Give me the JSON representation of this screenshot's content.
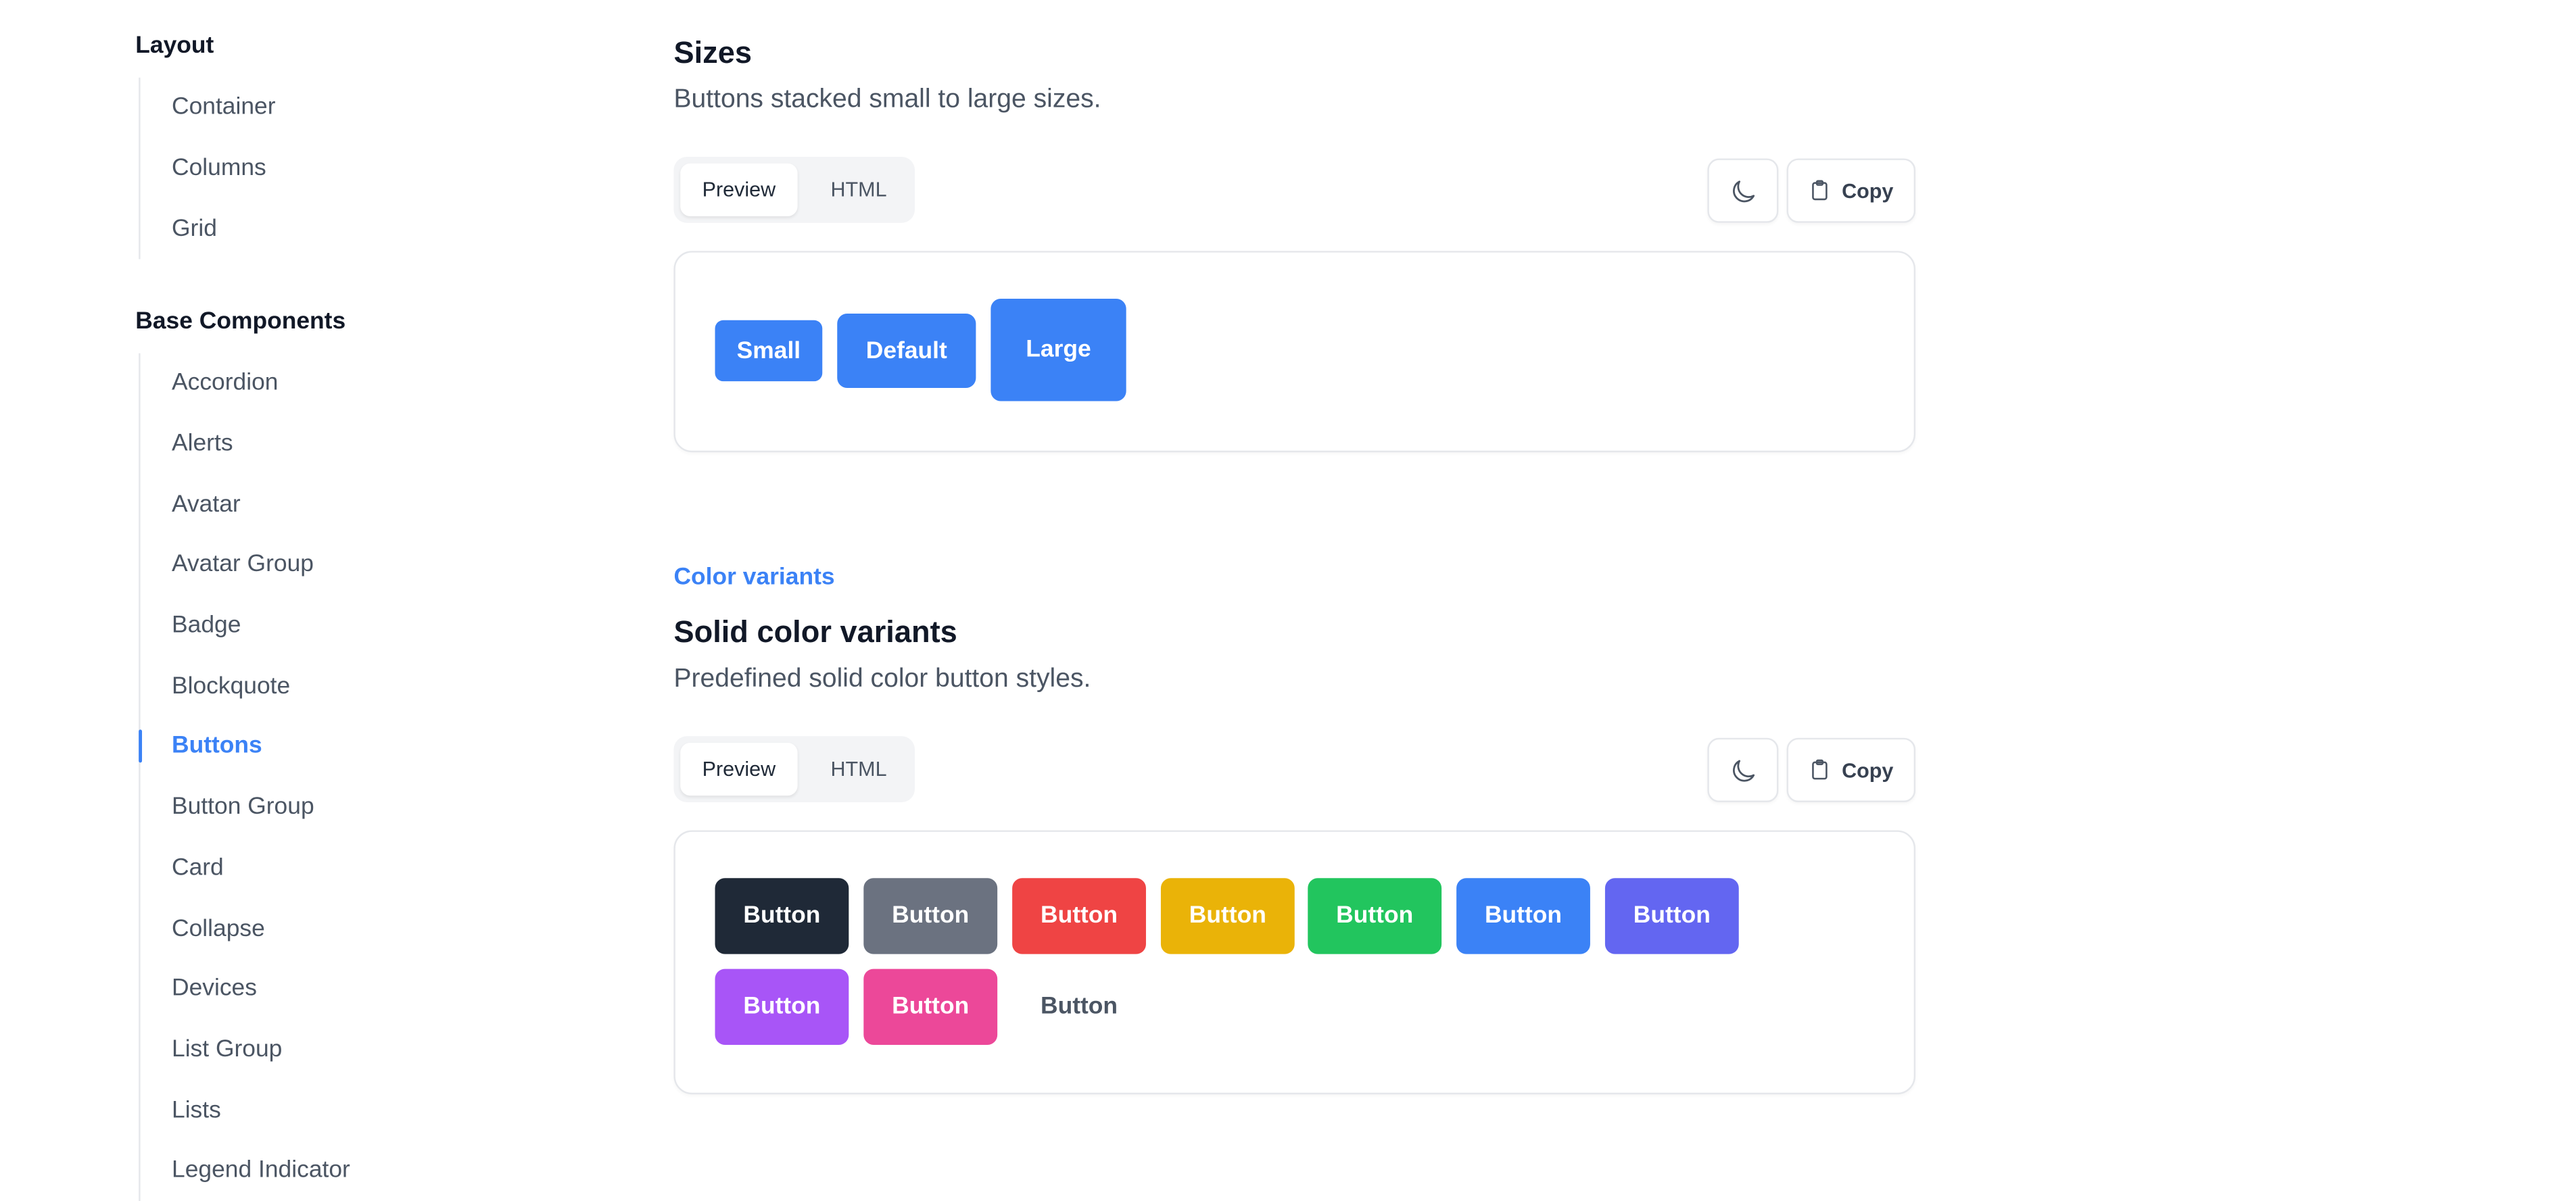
{
  "sidebar": {
    "groups": [
      {
        "title": "Layout",
        "items": [
          {
            "label": "Container",
            "active": false
          },
          {
            "label": "Columns",
            "active": false
          },
          {
            "label": "Grid",
            "active": false
          }
        ]
      },
      {
        "title": "Base Components",
        "items": [
          {
            "label": "Accordion",
            "active": false
          },
          {
            "label": "Alerts",
            "active": false
          },
          {
            "label": "Avatar",
            "active": false
          },
          {
            "label": "Avatar Group",
            "active": false
          },
          {
            "label": "Badge",
            "active": false
          },
          {
            "label": "Blockquote",
            "active": false
          },
          {
            "label": "Buttons",
            "active": true
          },
          {
            "label": "Button Group",
            "active": false
          },
          {
            "label": "Card",
            "active": false
          },
          {
            "label": "Collapse",
            "active": false
          },
          {
            "label": "Devices",
            "active": false
          },
          {
            "label": "List Group",
            "active": false
          },
          {
            "label": "Lists",
            "active": false
          },
          {
            "label": "Legend Indicator",
            "active": false
          }
        ]
      }
    ]
  },
  "sections": {
    "sizes": {
      "title": "Sizes",
      "description": "Buttons stacked small to large sizes.",
      "tabs": {
        "preview": "Preview",
        "html": "HTML",
        "selected": "Preview"
      },
      "copy_label": "Copy",
      "dark_mode_icon": "moon-icon",
      "copy_icon": "clipboard-icon",
      "buttons": [
        {
          "label": "Small",
          "size": "small",
          "color": "#3b82f6"
        },
        {
          "label": "Default",
          "size": "default",
          "color": "#3b82f6"
        },
        {
          "label": "Large",
          "size": "large",
          "color": "#3b82f6"
        }
      ]
    },
    "solid": {
      "eyebrow": "Color variants",
      "title": "Solid color variants",
      "description": "Predefined solid color button styles.",
      "tabs": {
        "preview": "Preview",
        "html": "HTML",
        "selected": "Preview"
      },
      "copy_label": "Copy",
      "dark_mode_icon": "moon-icon",
      "copy_icon": "clipboard-icon",
      "buttons": [
        {
          "label": "Button",
          "variant": "dark",
          "color": "#1f2937"
        },
        {
          "label": "Button",
          "variant": "gray",
          "color": "#6b7280"
        },
        {
          "label": "Button",
          "variant": "red",
          "color": "#ef4444"
        },
        {
          "label": "Button",
          "variant": "yellow",
          "color": "#eab308"
        },
        {
          "label": "Button",
          "variant": "green",
          "color": "#22c55e"
        },
        {
          "label": "Button",
          "variant": "blue",
          "color": "#3b82f6"
        },
        {
          "label": "Button",
          "variant": "indigo",
          "color": "#6366f1"
        },
        {
          "label": "Button",
          "variant": "purple",
          "color": "#a855f7"
        },
        {
          "label": "Button",
          "variant": "pink",
          "color": "#ec4899"
        },
        {
          "label": "Button",
          "variant": "white",
          "color": "#ffffff"
        }
      ]
    }
  },
  "colors": {
    "accent": "#3b82f6",
    "text_primary": "#111827",
    "text_secondary": "#4b5563",
    "border": "#e5e7eb"
  }
}
